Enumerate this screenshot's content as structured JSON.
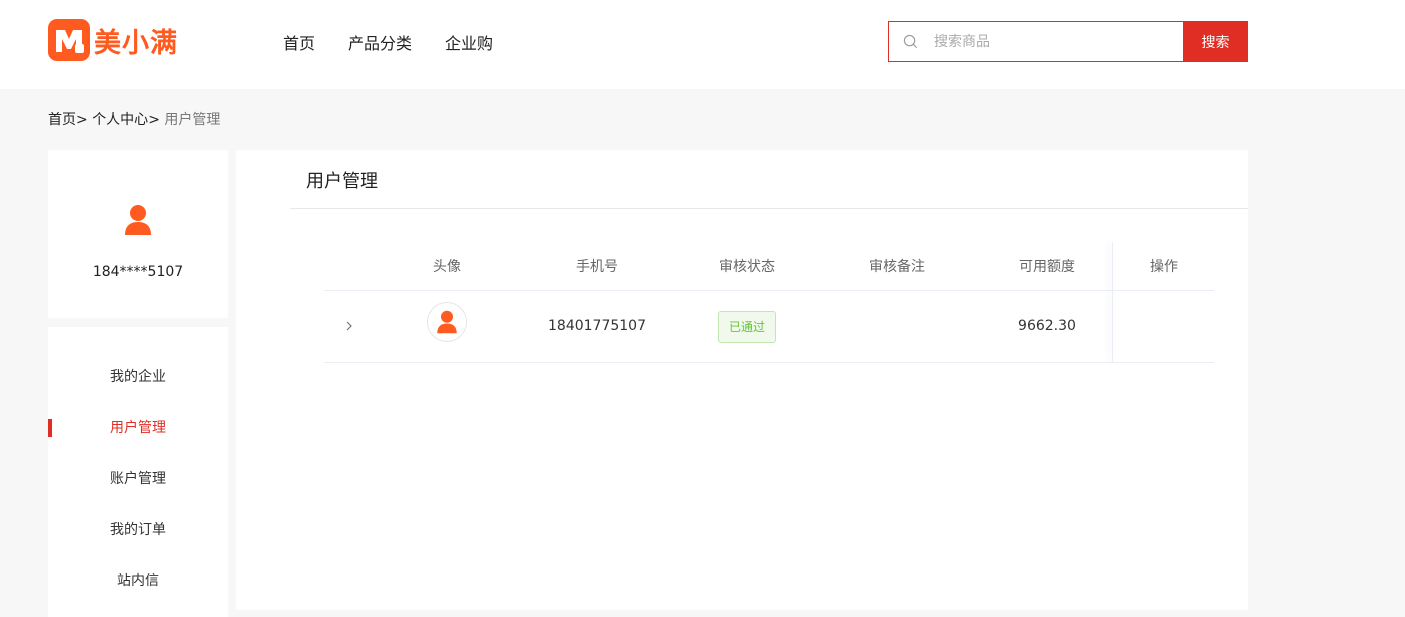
{
  "header": {
    "brand_name": "美小满",
    "nav": [
      "首页",
      "产品分类",
      "企业购"
    ],
    "search_placeholder": "搜索商品",
    "search_button": "搜索"
  },
  "breadcrumb": {
    "items": [
      "首页",
      "个人中心"
    ],
    "current": "用户管理"
  },
  "profile": {
    "phone_masked": "184****5107"
  },
  "menu": {
    "items": [
      "我的企业",
      "用户管理",
      "账户管理",
      "我的订单",
      "站内信"
    ],
    "active_index": 1
  },
  "panel": {
    "title": "用户管理"
  },
  "table": {
    "columns": [
      "头像",
      "手机号",
      "审核状态",
      "审核备注",
      "可用额度",
      "操作"
    ],
    "rows": [
      {
        "phone": "18401775107",
        "status": "已通过",
        "remark": "",
        "credit": "9662.30",
        "action": ""
      }
    ]
  },
  "colors": {
    "brand": "#ff5a1f",
    "accent": "#e02e24",
    "success": "#67c23a"
  }
}
